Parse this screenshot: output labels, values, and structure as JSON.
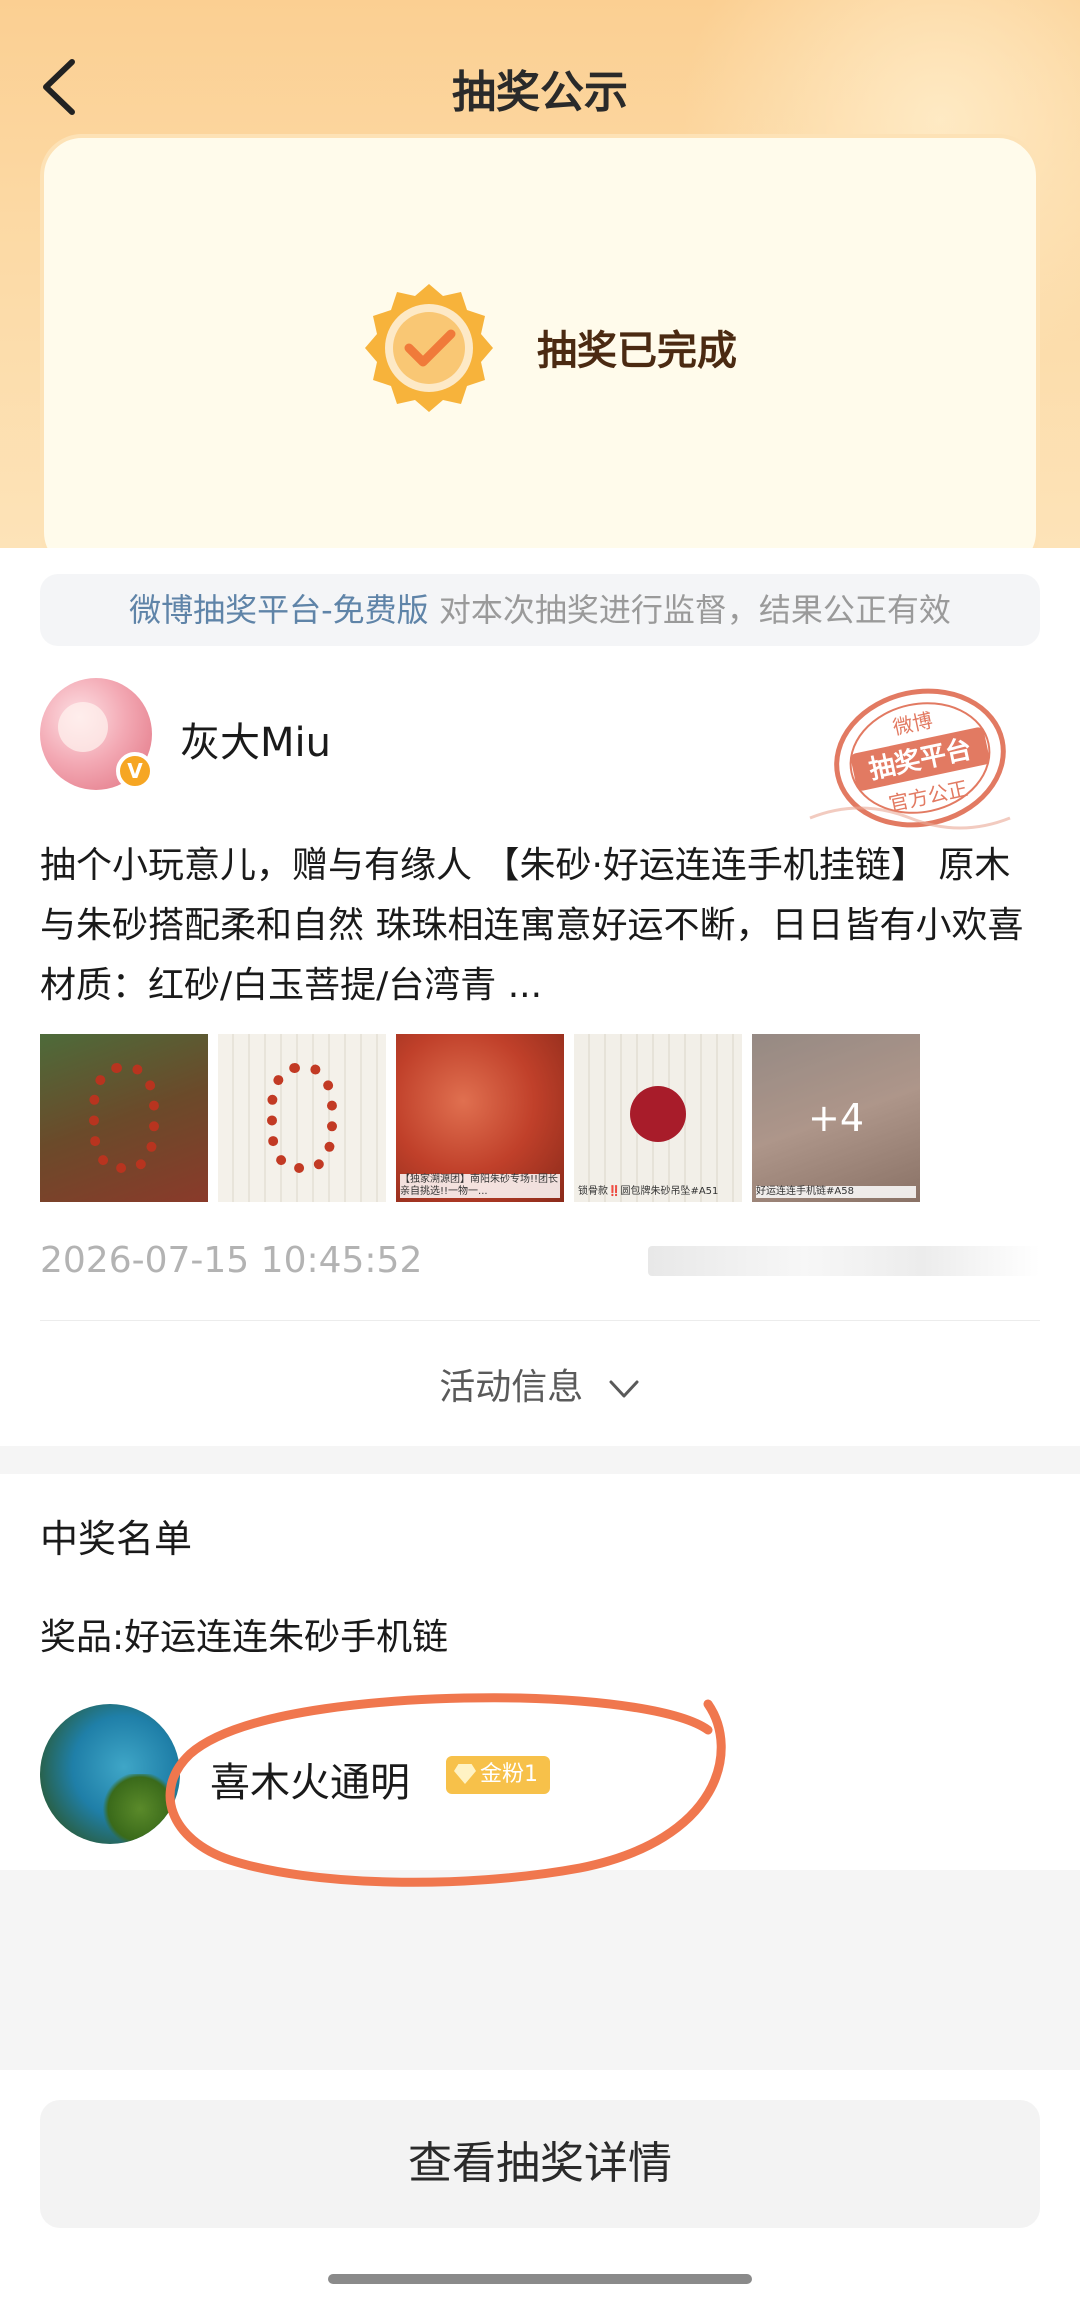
{
  "nav": {
    "title": "抽奖公示",
    "back_icon": "chevron-left-icon"
  },
  "status": {
    "text": "抽奖已完成",
    "badge_icon": "check-badge-icon"
  },
  "platform": {
    "link_text": "微博抽奖平台-免费版",
    "text": " 对本次抽奖进行监督，结果公正有效"
  },
  "post": {
    "author_name": "灰大Miu",
    "verified_badge": "V",
    "stamp": {
      "line1": "微博",
      "line2": "抽奖平台",
      "line3": "官方公正"
    },
    "content": "抽个小玩意儿，赠与有缘人 【朱砂·好运连连手机挂链】 原木与朱砂搭配柔和自然 珠珠相连寓意好运不断，日日皆有小欢喜 材质：红砂/白玉菩提/台湾青 ...",
    "images": [
      {
        "caption": ""
      },
      {
        "caption": ""
      },
      {
        "caption": "【独家溯源团】南阳朱砂专场!!团长亲自挑选!!一物一..."
      },
      {
        "caption": "锁骨款‼️圆包牌朱砂吊坠#A51"
      },
      {
        "caption": "好运连连手机链#A58"
      }
    ],
    "more_count": "+4",
    "time": "2026-07-15 10:45:52"
  },
  "activity": {
    "label": "活动信息",
    "chevron_icon": "chevron-down-icon"
  },
  "winners": {
    "title": "中奖名单",
    "prize": "奖品:好运连连朱砂手机链",
    "list": [
      {
        "name": "喜木火通明",
        "badge": "金粉1"
      }
    ]
  },
  "footer": {
    "button_label": "查看抽奖详情"
  },
  "colors": {
    "accent_orange": "#f08a5d",
    "hero_top": "#fbcf92",
    "status_text": "#4b2a12",
    "link_blue": "#5f84a8",
    "fan_badge": "#f7c14a"
  }
}
